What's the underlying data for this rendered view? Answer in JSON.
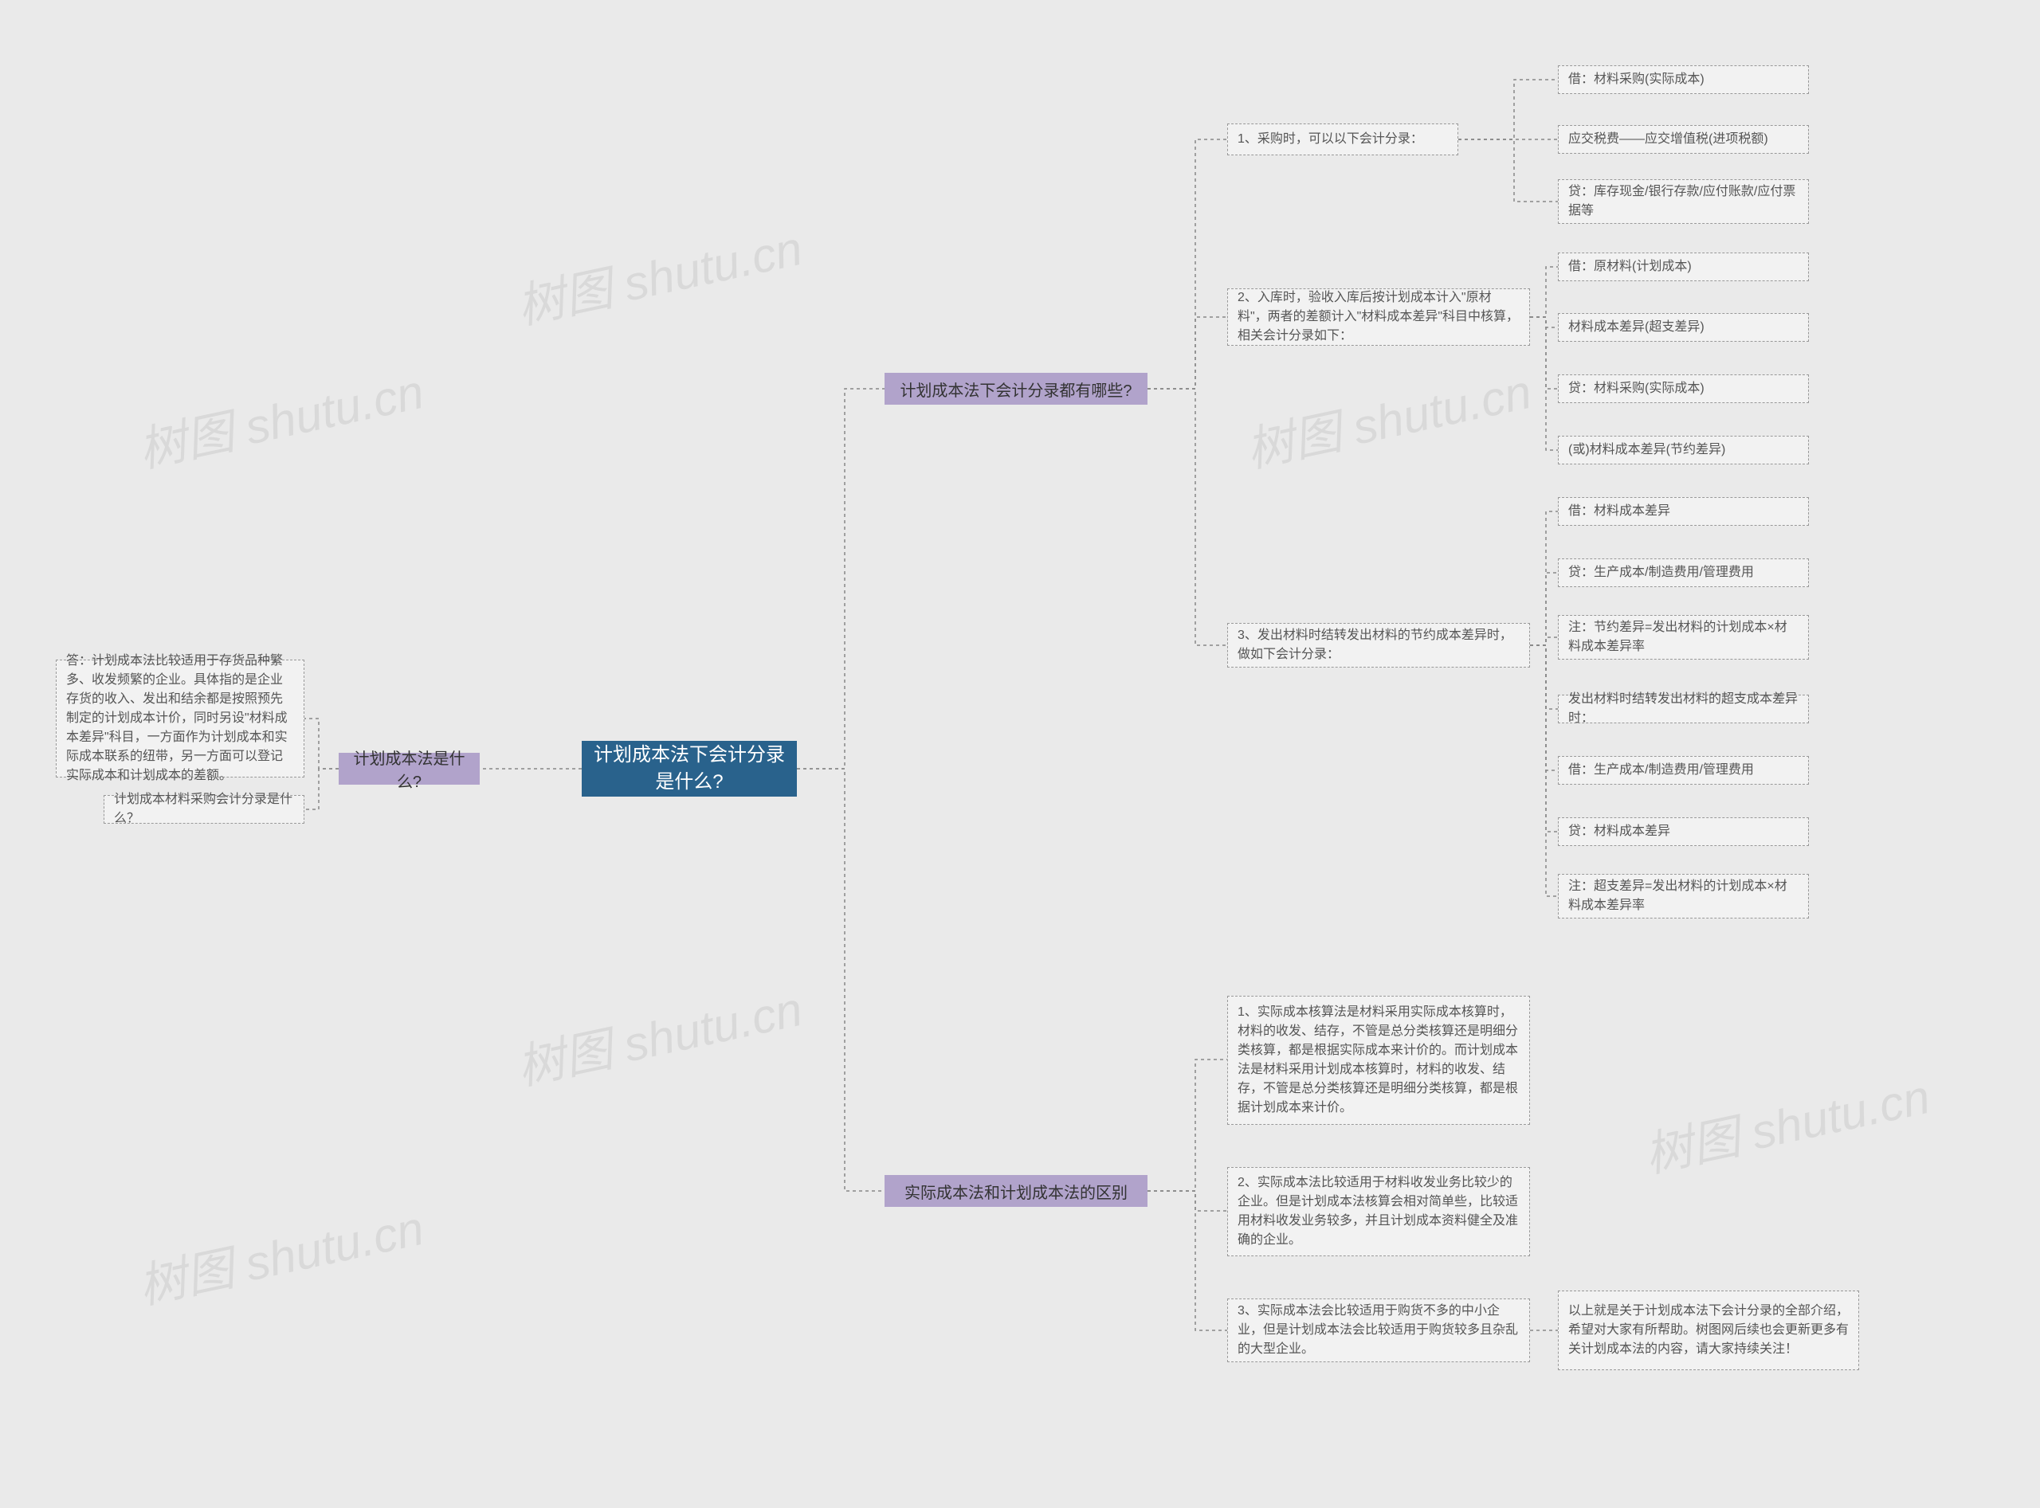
{
  "root": {
    "title": "计划成本法下会计分录是什么?"
  },
  "branches": {
    "b1": {
      "title": "计划成本法是什么?"
    },
    "b2": {
      "title": "计划成本法下会计分录都有哪些?"
    },
    "b3": {
      "title": "实际成本法和计划成本法的区别"
    }
  },
  "leaves": {
    "b1_l1": "答：计划成本法比较适用于存货品种繁多、收发频繁的企业。具体指的是企业存货的收入、发出和结余都是按照预先制定的计划成本计价，同时另设\"材料成本差异\"科目，一方面作为计划成本和实际成本联系的纽带，另一方面可以登记实际成本和计划成本的差额。",
    "b1_l2": "计划成本材料采购会计分录是什么？",
    "b2_s1": "1、采购时，可以以下会计分录：",
    "b2_s1_l1": "借：材料采购(实际成本)",
    "b2_s1_l2": "应交税费——应交增值税(进项税额)",
    "b2_s1_l3": "贷：库存现金/银行存款/应付账款/应付票据等",
    "b2_s2": "2、入库时，验收入库后按计划成本计入\"原材料\"，两者的差额计入\"材料成本差异\"科目中核算，相关会计分录如下：",
    "b2_s2_l1": "借：原材料(计划成本)",
    "b2_s2_l2": "材料成本差异(超支差异)",
    "b2_s2_l3": "贷：材料采购(实际成本)",
    "b2_s2_l4": "(或)材料成本差异(节约差异)",
    "b2_s3": "3、发出材料时结转发出材料的节约成本差异时，做如下会计分录：",
    "b2_s3_l1": "借：材料成本差异",
    "b2_s3_l2": "贷：生产成本/制造费用/管理费用",
    "b2_s3_l3": "注：节约差异=发出材料的计划成本×材料成本差异率",
    "b2_s3_l4": "发出材料时结转发出材料的超支成本差异时：",
    "b2_s3_l5": "借：生产成本/制造费用/管理费用",
    "b2_s3_l6": "贷：材料成本差异",
    "b2_s3_l7": "注：超支差异=发出材料的计划成本×材料成本差异率",
    "b3_l1": "1、实际成本核算法是材料采用实际成本核算时，材料的收发、结存，不管是总分类核算还是明细分类核算，都是根据实际成本来计价的。而计划成本法是材料采用计划成本核算时，材料的收发、结存，不管是总分类核算还是明细分类核算，都是根据计划成本来计价。",
    "b3_l2": "2、实际成本法比较适用于材料收发业务比较少的企业。但是计划成本法核算会相对简单些，比较适用材料收发业务较多，并且计划成本资料健全及准确的企业。",
    "b3_l3": "3、实际成本法会比较适用于购货不多的中小企业，但是计划成本法会比较适用于购货较多且杂乱的大型企业。",
    "b3_l3_sub": "以上就是关于计划成本法下会计分录的全部介绍，希望对大家有所帮助。树图网后续也会更新更多有关计划成本法的内容，请大家持续关注！"
  },
  "watermarks": [
    "树图 shutu.cn",
    "树图 shutu.cn",
    "树图 shutu.cn",
    "树图 shutu.cn",
    "树图 shutu.cn",
    "树图 shutu.cn"
  ]
}
